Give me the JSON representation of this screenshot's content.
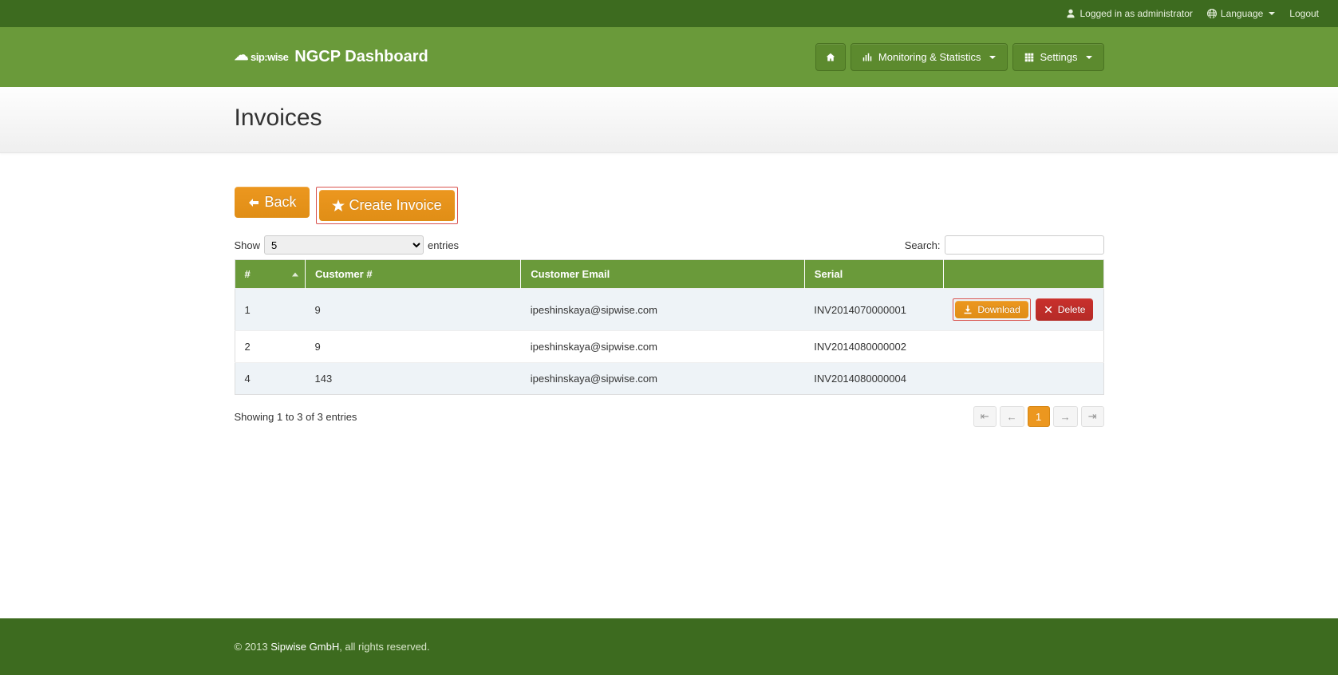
{
  "topbar": {
    "logged_in_text": "Logged in as administrator",
    "language_label": "Language",
    "logout_label": "Logout"
  },
  "header": {
    "brand_logo_text": "sip:wise",
    "brand_title": "NGCP Dashboard",
    "nav": {
      "monitoring_label": "Monitoring & Statistics",
      "settings_label": "Settings"
    }
  },
  "page": {
    "title": "Invoices"
  },
  "actions": {
    "back_label": "Back",
    "create_label": "Create Invoice"
  },
  "datatable": {
    "show_label": "Show",
    "entries_label": "entries",
    "page_size_value": "5",
    "search_label": "Search:",
    "search_value": "",
    "columns": {
      "id": "#",
      "customer": "Customer #",
      "email": "Customer Email",
      "serial": "Serial"
    },
    "rows": [
      {
        "id": "1",
        "customer": "9",
        "email": "ipeshinskaya@sipwise.com",
        "serial": "INV2014070000001"
      },
      {
        "id": "2",
        "customer": "9",
        "email": "ipeshinskaya@sipwise.com",
        "serial": "INV2014080000002"
      },
      {
        "id": "4",
        "customer": "143",
        "email": "ipeshinskaya@sipwise.com",
        "serial": "INV2014080000004"
      }
    ],
    "row_actions": {
      "download_label": "Download",
      "delete_label": "Delete"
    },
    "info_text": "Showing 1 to 3 of 3 entries",
    "pager": {
      "first": "⇤",
      "prev": "←",
      "current": "1",
      "next": "→",
      "last": "⇥"
    }
  },
  "footer": {
    "copyright_prefix": "© 2013 ",
    "company": "Sipwise GmbH",
    "copyright_suffix": ", all rights reserved."
  }
}
